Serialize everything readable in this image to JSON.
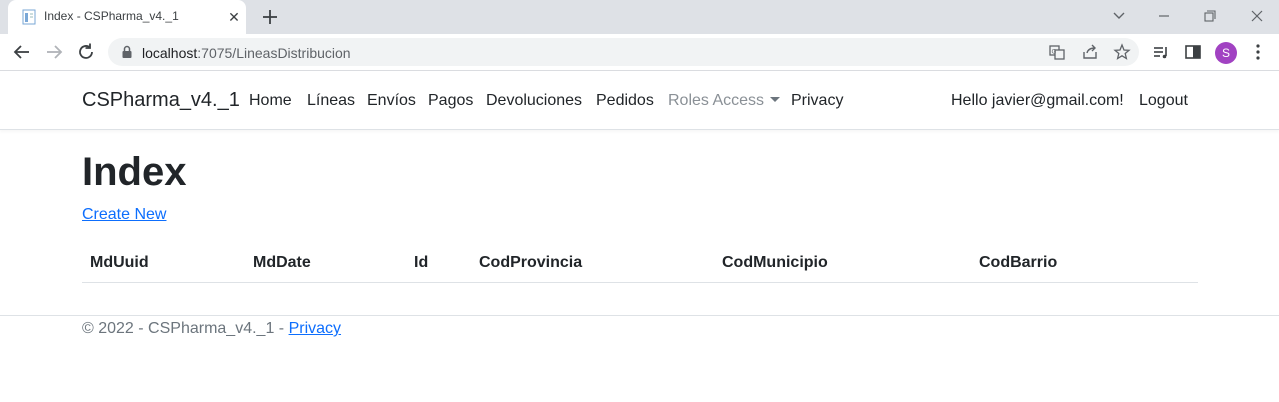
{
  "browser": {
    "tab_title": "Index - CSPharma_v4._1",
    "tab_close": "✕",
    "url_host": "localhost",
    "url_path": ":7075/LineasDistribucion",
    "profile_initial": "S",
    "colors": {
      "tabstrip": "#dee1e6",
      "avatar": "#a142c2"
    }
  },
  "navbar": {
    "brand": "CSPharma_v4._1",
    "links": [
      "Home",
      "Líneas",
      "Envíos",
      "Pagos",
      "Devoluciones",
      "Pedidos",
      "Roles Access",
      "Privacy"
    ],
    "greeting": "Hello javier@gmail.com!",
    "logout": "Logout"
  },
  "main": {
    "title": "Index",
    "create_link": "Create New",
    "table_headers": [
      "MdUuid",
      "MdDate",
      "Id",
      "CodProvincia",
      "CodMunicipio",
      "CodBarrio"
    ]
  },
  "footer": {
    "text": "© 2022 - CSPharma_v4._1 - ",
    "privacy_link": "Privacy",
    "link_color": "#0d6efd"
  }
}
